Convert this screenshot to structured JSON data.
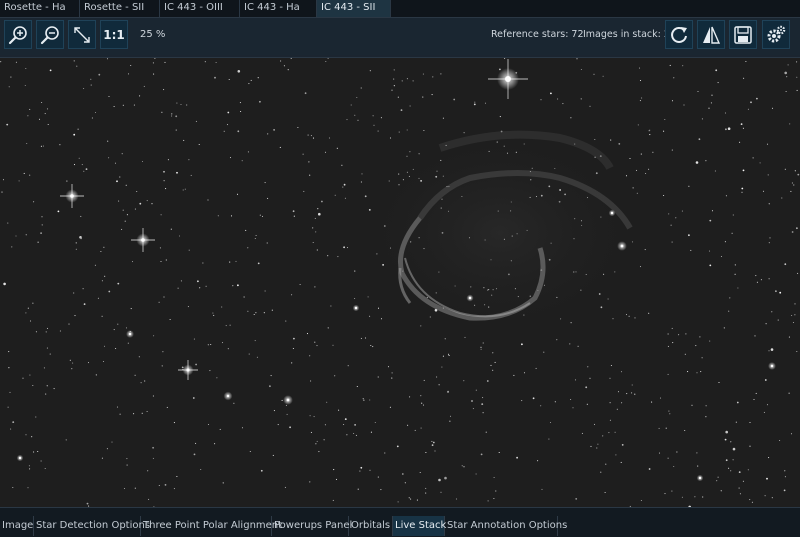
{
  "top_tabs": [
    {
      "label": "Rosette - Ha",
      "active": false
    },
    {
      "label": "Rosette - SII",
      "active": false
    },
    {
      "label": "IC 443 - OIII",
      "active": false
    },
    {
      "label": "IC 443 - Ha",
      "active": false
    },
    {
      "label": "IC 443 - SII",
      "active": true
    }
  ],
  "toolbar": {
    "one_to_one_label": "1:1",
    "zoom_level": "25 %",
    "reference_stars": "Reference stars: 72",
    "images_in_stack": "Images in stack: 2",
    "icons": {
      "zoom_in": "zoom-in-icon",
      "zoom_out": "zoom-out-icon",
      "fit": "fit-to-window-icon",
      "reset": "refresh-icon",
      "flip": "flip-icon",
      "save": "save-icon",
      "settings": "settings-gears-icon"
    }
  },
  "bottom_tabs": [
    {
      "label": "Image",
      "active": false
    },
    {
      "label": "Star Detection Options",
      "active": false
    },
    {
      "label": "Three Point Polar Alignment",
      "active": false
    },
    {
      "label": "Powerups Panel",
      "active": false
    },
    {
      "label": "Orbitals",
      "active": false
    },
    {
      "label": "Live Stack",
      "active": true
    },
    {
      "label": "Star Annotation Options",
      "active": false
    }
  ],
  "colors": {
    "accent": "#1e3442",
    "button_bg": "#102a3b",
    "image_bg": "#1e1e1e"
  }
}
